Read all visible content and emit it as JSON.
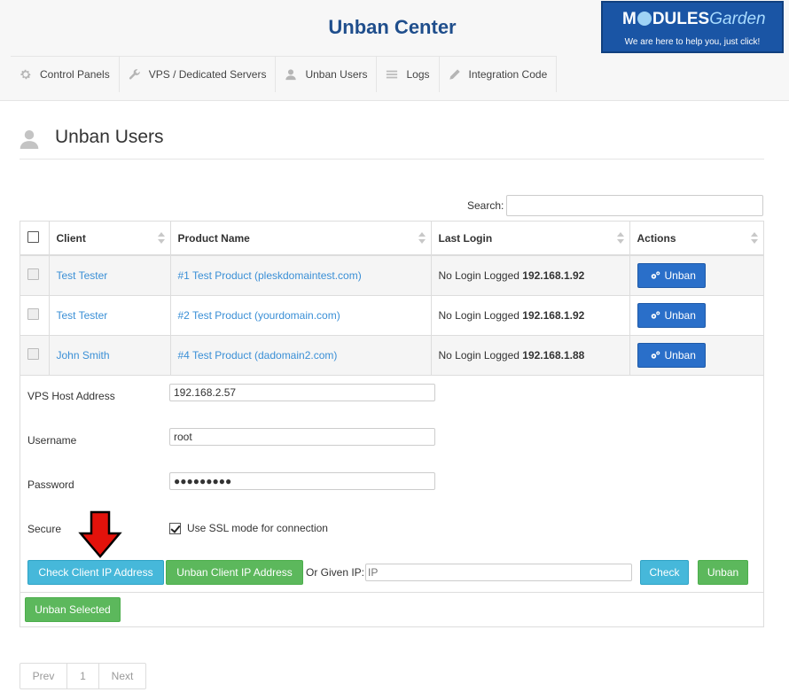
{
  "app": {
    "title": "Unban Center"
  },
  "brand": {
    "name_part1": "M",
    "name_part2": "DULES",
    "name_part3": "Garden",
    "tagline": "We are here to help you, just click!"
  },
  "nav": {
    "items": [
      {
        "label": "Control Panels",
        "icon": "gear-icon"
      },
      {
        "label": "VPS / Dedicated Servers",
        "icon": "wrench-icon"
      },
      {
        "label": "Unban Users",
        "icon": "user-icon"
      },
      {
        "label": "Logs",
        "icon": "list-icon"
      },
      {
        "label": "Integration Code",
        "icon": "pencil-icon"
      }
    ]
  },
  "page": {
    "title": "Unban Users",
    "icon": "user-icon"
  },
  "search": {
    "label": "Search:",
    "value": ""
  },
  "table": {
    "columns": [
      "Client",
      "Product Name",
      "Last Login",
      "Actions"
    ],
    "rows": [
      {
        "client": "Test Tester",
        "product": "#1 Test Product (pleskdomaintest.com)",
        "login_text": "No Login Logged",
        "login_ip": "192.168.1.92",
        "action": "Unban"
      },
      {
        "client": "Test Tester",
        "product": "#2 Test Product (yourdomain.com)",
        "login_text": "No Login Logged",
        "login_ip": "192.168.1.92",
        "action": "Unban"
      },
      {
        "client": "John Smith",
        "product": "#4 Test Product (dadomain2.com)",
        "login_text": "No Login Logged",
        "login_ip": "192.168.1.88",
        "action": "Unban"
      }
    ]
  },
  "form": {
    "host_label": "VPS Host Address",
    "host_value": "192.168.2.57",
    "username_label": "Username",
    "username_value": "root",
    "password_label": "Password",
    "password_value": "●●●●●●●●●",
    "secure_label": "Secure",
    "ssl_label": "Use SSL mode for connection",
    "ssl_checked": true
  },
  "actions": {
    "check_client_ip": "Check Client IP Address",
    "unban_client_ip": "Unban Client IP Address",
    "given_ip_label": "Or Given IP:",
    "given_ip_placeholder": "IP",
    "check": "Check",
    "unban": "Unban",
    "unban_selected": "Unban Selected"
  },
  "pagination": {
    "prev": "Prev",
    "current": "1",
    "next": "Next"
  },
  "colors": {
    "primary": "#2a6fc9",
    "info": "#46b8da",
    "success": "#5cb85c",
    "title": "#1f4e8c",
    "link": "#3a8fd6",
    "arrow": "#e3120b"
  }
}
